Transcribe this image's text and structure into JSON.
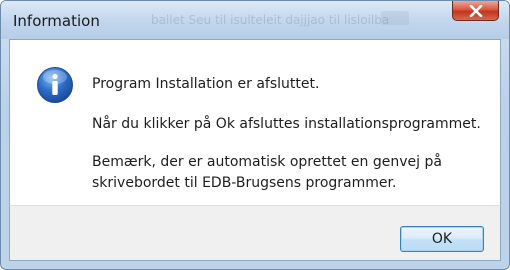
{
  "window": {
    "title": "Information"
  },
  "background_hint": {
    "ghost_title": "ballet Seu til isulteleit dajjjao til lisloilba"
  },
  "message": {
    "line1": "Program Installation er afsluttet.",
    "line2": "Når du klikker på Ok afsluttes installationsprogrammet.",
    "line3": "Bemærk, der er automatisk oprettet en genvej på",
    "line4": "skrivebordet til EDB-Brugsens programmer."
  },
  "buttons": {
    "ok_label": "OK"
  },
  "icons": {
    "info": "information-icon",
    "close": "close-icon"
  },
  "colors": {
    "close_button": "#d9573f",
    "info_icon": "#2d6dc9",
    "title_bar": "#c3d7ee"
  }
}
